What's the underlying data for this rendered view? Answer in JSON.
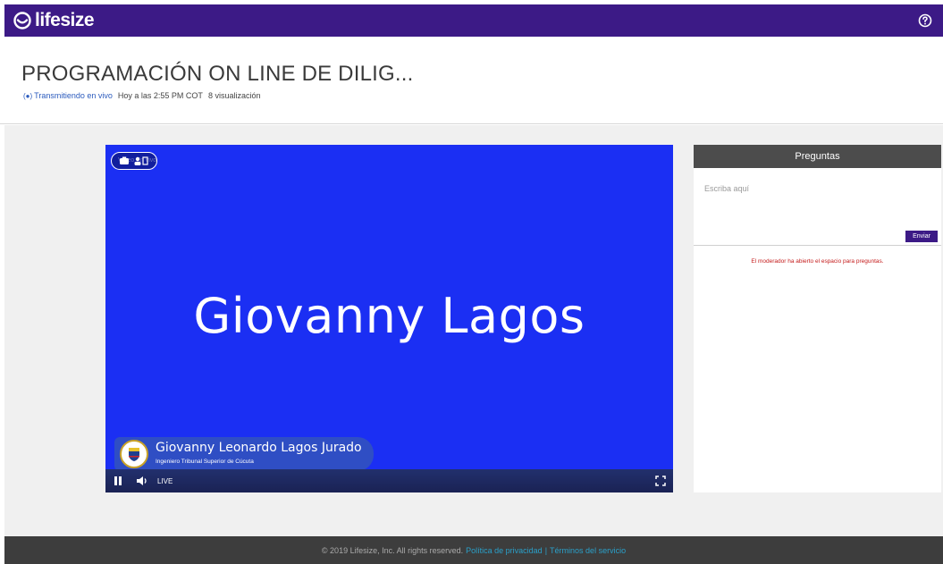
{
  "app": {
    "brand_name": "lifesize",
    "accent_color": "#3c1a86"
  },
  "header": {
    "title": "PROGRAMACIÓN ON LINE DE DILIG...",
    "live_status": "Transmitiendo en vivo",
    "date": "Hoy a las 2:55 PM COT",
    "views": "8 visualización"
  },
  "video": {
    "background_color": "#1b2ff3",
    "presenter_big": "Giovanny Lagos",
    "lower_third_name": "Giovanny Leonardo Lagos Jurado",
    "lower_third_role": "Ingeniero Tribunal Superior de Cúcuta",
    "watermark": "Vídeo En vivo",
    "live_label": "LIVE",
    "controls": {
      "pause_icon": "pause-icon",
      "volume_icon": "volume-icon",
      "fullscreen_icon": "fullscreen-icon"
    }
  },
  "questions": {
    "title": "Preguntas",
    "placeholder": "Escriba aquí",
    "send_label": "Enviar",
    "moderator_message": "El moderador ha abierto el espacio para preguntas."
  },
  "footer": {
    "copyright": "© 2019 Lifesize, Inc. All rights reserved.",
    "privacy_link": "Política de privacidad",
    "separator": "|",
    "terms_link": "Términos del servicio"
  }
}
